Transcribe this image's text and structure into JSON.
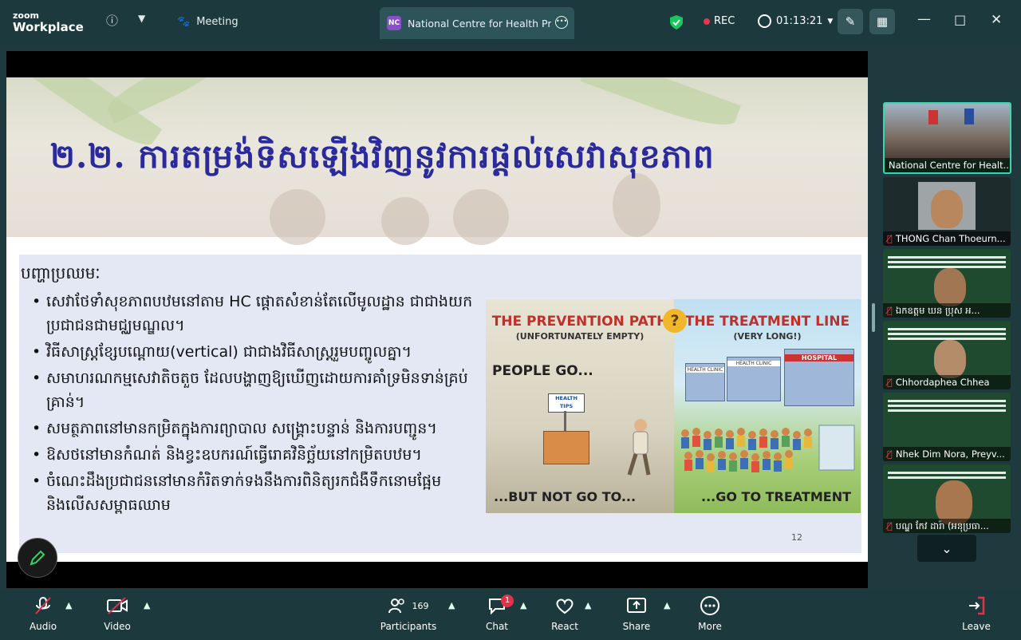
{
  "app": {
    "logo_line1": "zoom",
    "logo_line2": "Workplace",
    "meeting_label": "Meeting"
  },
  "tab": {
    "badge": "NC",
    "title": "National Centre for Health Promo"
  },
  "status": {
    "rec": "REC",
    "timer": "01:13:21"
  },
  "slide": {
    "heading": "២.២. ការតម្រង់ទិសឡើងវិញនូវការផ្តល់សេវាសុខភាព",
    "problem_label": "បញ្ហាប្រឈមៈ",
    "bullets": [
      "សេវាថែទាំសុខភាពបឋមនៅតាម HC ផ្តោតសំខាន់តែលើមូលដ្ឋាន ជាជាងយកប្រជាជនជាមជ្ឈមណ្ឌល។",
      "វិធីសាស្ត្រខ្សែបណ្តោយ(vertical) ជាជាងវិធីសាស្ត្ររួមបញ្ចូលគ្នា។",
      "សមាហរណកម្មសេវាតិចតួច ដែលបង្ហាញឱ្យឃើញដោយការគាំទ្រមិនទាន់គ្រប់គ្រាន់។",
      "សមត្ថភាពនៅមានកម្រិតក្នុងការព្យាបាល សង្គ្រោះបន្ទាន់ និងការបញ្ជូន។",
      "ឱសថនៅមានកំណត់ និងខ្វះឧបករណ៍ធ្វើរោគវិនិច្ឆ័យនៅកម្រិតបឋម។",
      "ចំណេះដឹងប្រជាជននៅមានកំរិតទាក់ទងនឹងការពិនិត្យរកជំងឺទឹកនោមផ្អែម និងលើសសម្ពាធឈាម"
    ],
    "page_number": "12",
    "illustration": {
      "left_title": "THE PREVENTION PATH",
      "left_sub": "(UNFORTUNATELY EMPTY)",
      "left_mid": "PEOPLE GO...",
      "left_bottom": "...BUT NOT GO TO...",
      "stand_sign": "HEALTH TIPS",
      "center_mark": "?",
      "right_title": "THE TREATMENT LINE",
      "right_sub": "(VERY LONG!)",
      "right_bottom": "...GO TO TREATMENT",
      "hospital_sign": "HOSPITAL",
      "clinic_sign_1": "HEALTH CLINIC",
      "clinic_sign_2": "HEALTH CLINIC"
    }
  },
  "gallery": [
    {
      "name": "National Centre for Healt..."
    },
    {
      "name": "THONG Chan Thoeurn..."
    },
    {
      "name": "ឯកឧត្តម ឃន ប្រុស អ..."
    },
    {
      "name": "Chhordaphea Chhea"
    },
    {
      "name": "Nhek Dim Nora, Preyv..."
    },
    {
      "name": "បណ្ឌ កែវ ដារ៉ា (អនុប្រធា..."
    }
  ],
  "toolbar": {
    "audio": "Audio",
    "video": "Video",
    "participants": "Participants",
    "participants_count": "169",
    "chat": "Chat",
    "chat_badge": "1",
    "react": "React",
    "share": "Share",
    "more": "More",
    "leave": "Leave"
  },
  "colors": {
    "bg": "#1e3a3f",
    "heading": "#2a2a9c",
    "rec_dot": "#e8384f",
    "active_border": "#3bd6b0",
    "leave": "#e4314a"
  }
}
